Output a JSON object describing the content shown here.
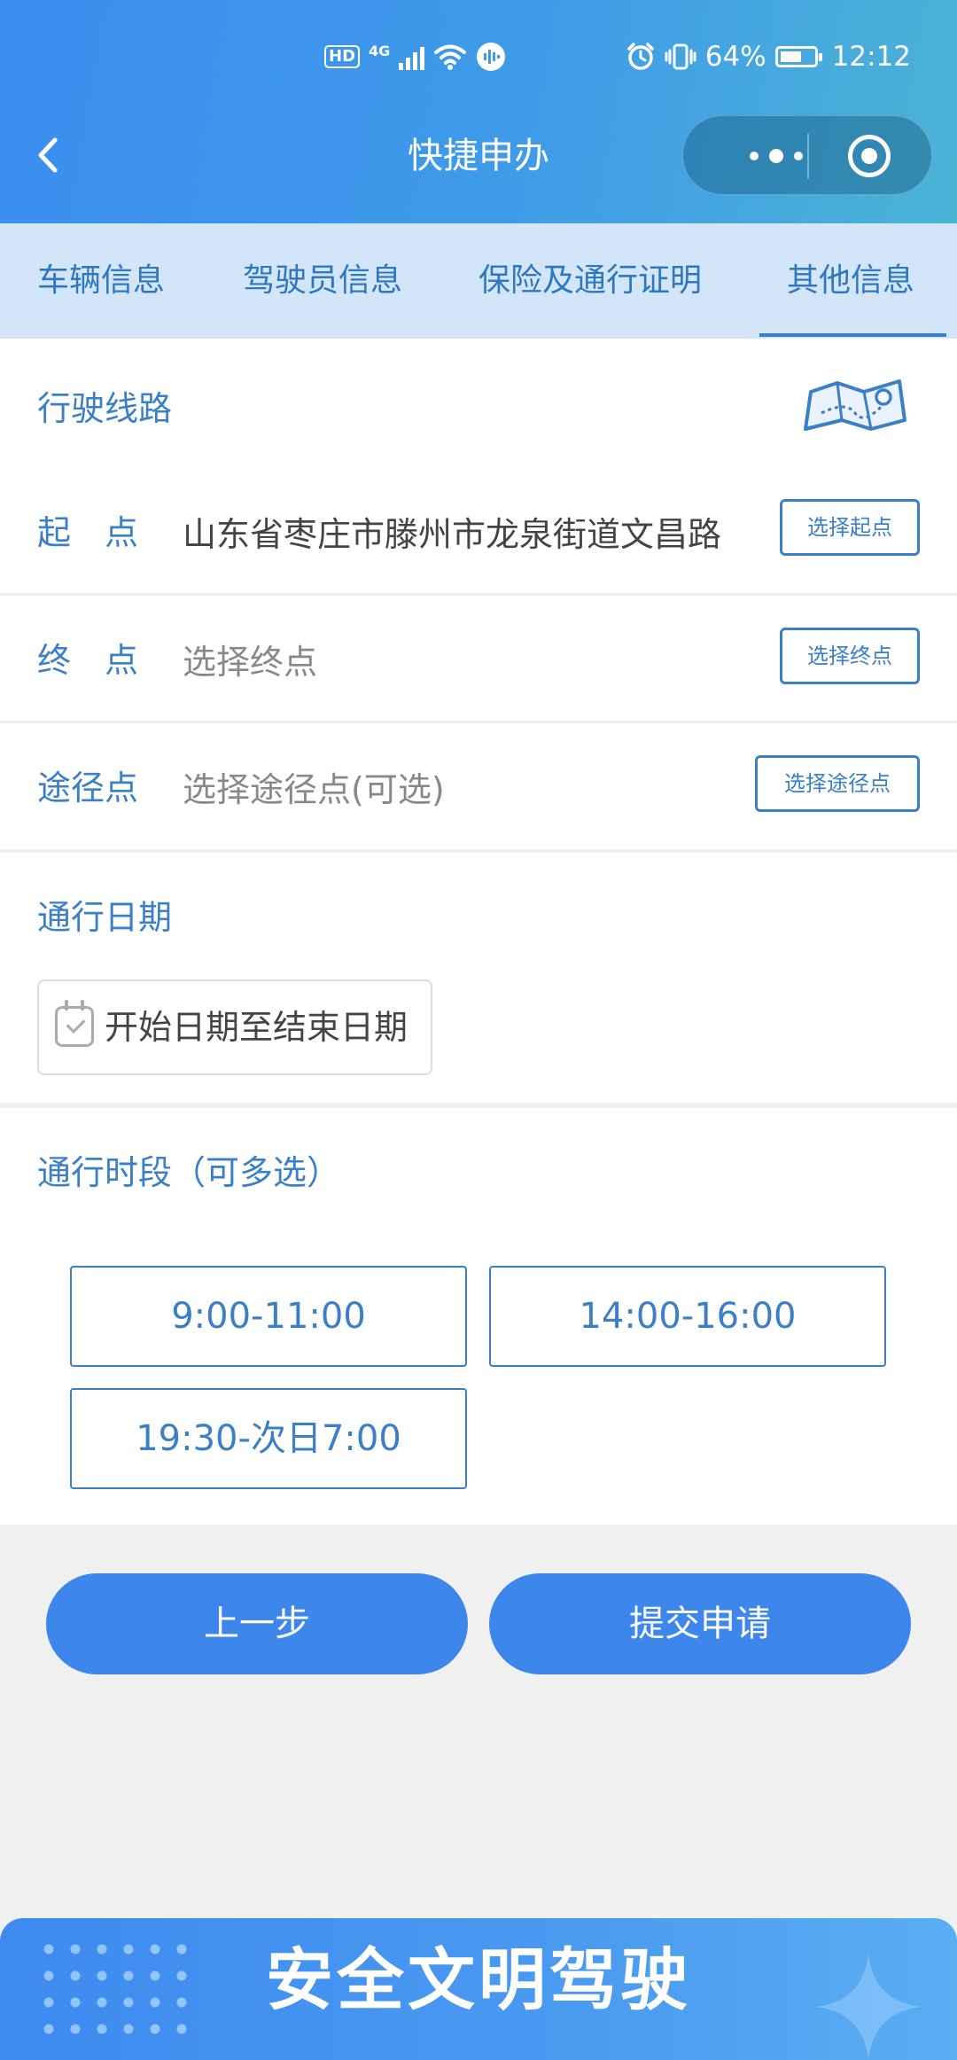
{
  "status_bar": {
    "hd": "HD",
    "network": "4G",
    "battery_percent": "64%",
    "battery_level": 0.64,
    "time": "12:12"
  },
  "navbar": {
    "title": "快捷申办",
    "icons": [
      "back-icon",
      "more-icon",
      "close-mini-program-icon"
    ]
  },
  "tabs": [
    {
      "label": "车辆信息",
      "active": false
    },
    {
      "label": "驾驶员信息",
      "active": false
    },
    {
      "label": "保险及通行证明",
      "active": false
    },
    {
      "label": "其他信息",
      "active": true
    }
  ],
  "route": {
    "title": "行驶线路",
    "map_icon": "map-icon",
    "rows": [
      {
        "label": "起　点",
        "value": "山东省枣庄市滕州市龙泉街道文昌路",
        "placeholder": false,
        "button": "选择起点"
      },
      {
        "label": "终　点",
        "value": "选择终点",
        "placeholder": true,
        "button": "选择终点"
      },
      {
        "label": "途径点",
        "value": "选择途径点(可选)",
        "placeholder": true,
        "button": "选择途径点"
      }
    ]
  },
  "date": {
    "title": "通行日期",
    "placeholder": "开始日期至结束日期"
  },
  "time_slots": {
    "title": "通行时段（可多选）",
    "options": [
      "9:00-11:00",
      "14:00-16:00",
      "19:30-次日7:00"
    ]
  },
  "actions": {
    "prev": "上一步",
    "submit": "提交申请"
  },
  "banner": {
    "text": "安全文明驾驶"
  },
  "colors": {
    "primary": "#3c86ec",
    "label_blue": "#3a7fc7",
    "tab_bg": "#d3e6f9",
    "page_bg": "#f0f0f0"
  }
}
